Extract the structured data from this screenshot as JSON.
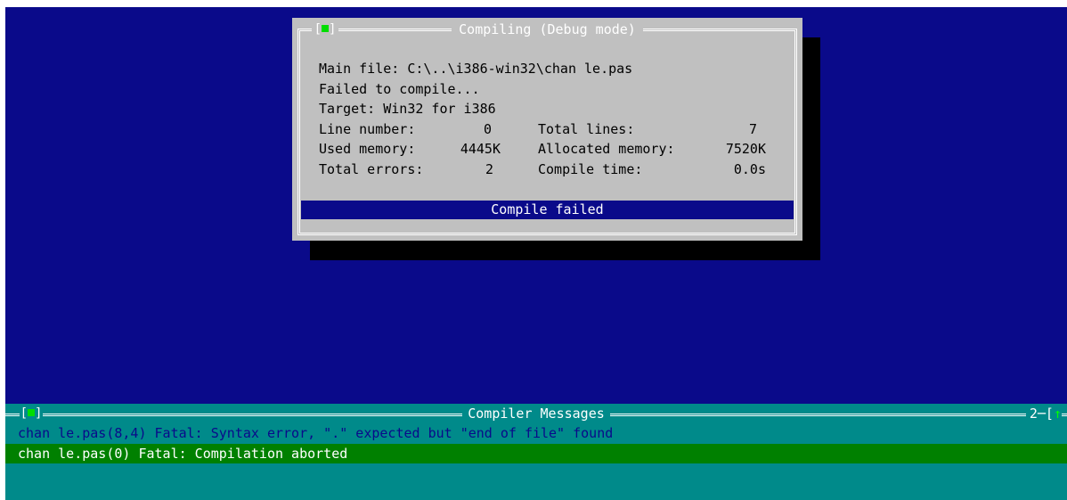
{
  "dialog": {
    "title": "Compiling  (Debug mode)",
    "close_glyph_left": "[",
    "close_glyph_right": "]",
    "main_file": "Main file: C:\\..\\i386-win32\\chan le.pas",
    "status_line": "Failed to compile...",
    "target": "Target: Win32 for i386",
    "stats": {
      "line_number_label": "Line number:",
      "line_number_value": "0",
      "total_lines_label": "Total lines:",
      "total_lines_value": "7",
      "used_memory_label": "Used memory:",
      "used_memory_value": "4445K",
      "allocated_memory_label": "Allocated memory:",
      "allocated_memory_value": "7520K",
      "total_errors_label": "Total errors:",
      "total_errors_value": "2",
      "compile_time_label": "Compile time:",
      "compile_time_value": "0.0s"
    },
    "result": "Compile failed"
  },
  "messages": {
    "title": "Compiler Messages",
    "close_glyph_left": "[",
    "close_glyph_right": "]",
    "window_number": "2",
    "scroll_glyph": "↑",
    "lines": [
      "chan le.pas(8,4) Fatal: Syntax error, \".\" expected but \"end of file\" found",
      "chan le.pas(0) Fatal: Compilation aborted"
    ]
  },
  "colors": {
    "desktop": "#0a0a8a",
    "dialog": "#c0c0c0",
    "messages_panel": "#008a8a",
    "selected_line": "#008000",
    "close_indicator": "#00dd00"
  }
}
